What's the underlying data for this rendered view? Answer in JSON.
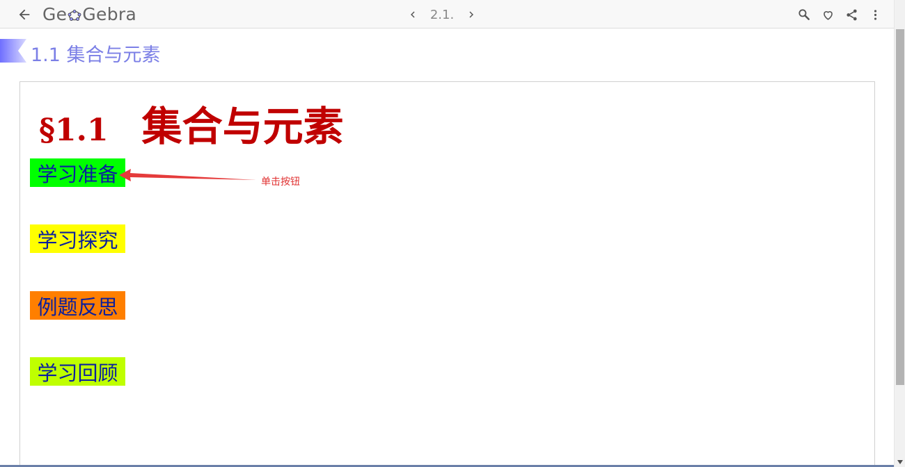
{
  "app": {
    "brand": "GeoGebra",
    "brand_prefix": "Ge",
    "brand_suffix": "Gebra"
  },
  "topbar": {
    "back_icon": "arrow-left-icon",
    "prev_icon": "chevron-left-icon",
    "page_label": "2.1.",
    "next_icon": "chevron-right-icon",
    "actions": [
      "search-icon",
      "heart-icon",
      "share-icon",
      "more-vert-icon"
    ]
  },
  "section": {
    "title": "1.1 集合与元素"
  },
  "applet": {
    "title_number": "§1.1",
    "title_text": "集合与元素",
    "buttons": [
      {
        "label": "学习准备",
        "color": "#00ff00"
      },
      {
        "label": "学习探究",
        "color": "#ffff00"
      },
      {
        "label": "例题反思",
        "color": "#ff7f00"
      },
      {
        "label": "学习回顾",
        "color": "#bfff00"
      }
    ],
    "annotation": "单击按钮"
  },
  "colors": {
    "title_red": "#c00000",
    "section_blue": "#7b7fe6",
    "button_text": "#0a1f9e",
    "annotation_red": "#e03030"
  }
}
